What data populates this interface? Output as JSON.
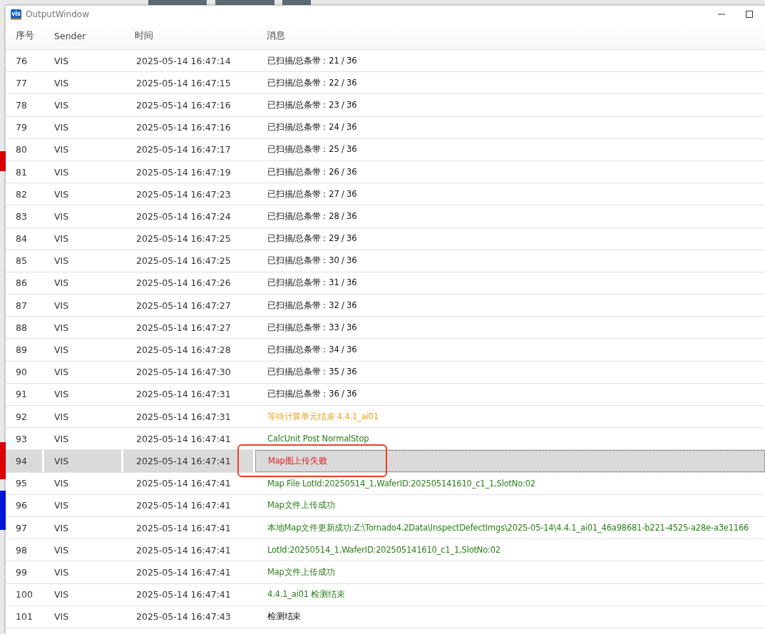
{
  "window": {
    "icon_text": "vis",
    "title": "OutputWindow"
  },
  "table": {
    "columns": [
      "序号",
      "Sender",
      "时间",
      "消息"
    ],
    "rows": [
      {
        "no": "76",
        "sender": "VIS",
        "time": "2025-05-14 16:47:14",
        "message": "已扫描/总条带：21 / 36",
        "kind": "info",
        "selected": false
      },
      {
        "no": "77",
        "sender": "VIS",
        "time": "2025-05-14 16:47:15",
        "message": "已扫描/总条带：22 / 36",
        "kind": "info",
        "selected": false
      },
      {
        "no": "78",
        "sender": "VIS",
        "time": "2025-05-14 16:47:16",
        "message": "已扫描/总条带：23 / 36",
        "kind": "info",
        "selected": false
      },
      {
        "no": "79",
        "sender": "VIS",
        "time": "2025-05-14 16:47:16",
        "message": "已扫描/总条带：24 / 36",
        "kind": "info",
        "selected": false
      },
      {
        "no": "80",
        "sender": "VIS",
        "time": "2025-05-14 16:47:17",
        "message": "已扫描/总条带：25 / 36",
        "kind": "info",
        "selected": false
      },
      {
        "no": "81",
        "sender": "VIS",
        "time": "2025-05-14 16:47:19",
        "message": "已扫描/总条带：26 / 36",
        "kind": "info",
        "selected": false
      },
      {
        "no": "82",
        "sender": "VIS",
        "time": "2025-05-14 16:47:23",
        "message": "已扫描/总条带：27 / 36",
        "kind": "info",
        "selected": false
      },
      {
        "no": "83",
        "sender": "VIS",
        "time": "2025-05-14 16:47:24",
        "message": "已扫描/总条带：28 / 36",
        "kind": "info",
        "selected": false
      },
      {
        "no": "84",
        "sender": "VIS",
        "time": "2025-05-14 16:47:25",
        "message": "已扫描/总条带：29 / 36",
        "kind": "info",
        "selected": false
      },
      {
        "no": "85",
        "sender": "VIS",
        "time": "2025-05-14 16:47:25",
        "message": "已扫描/总条带：30 / 36",
        "kind": "info",
        "selected": false
      },
      {
        "no": "86",
        "sender": "VIS",
        "time": "2025-05-14 16:47:26",
        "message": "已扫描/总条带：31 / 36",
        "kind": "info",
        "selected": false
      },
      {
        "no": "87",
        "sender": "VIS",
        "time": "2025-05-14 16:47:27",
        "message": "已扫描/总条带：32 / 36",
        "kind": "info",
        "selected": false
      },
      {
        "no": "88",
        "sender": "VIS",
        "time": "2025-05-14 16:47:27",
        "message": "已扫描/总条带：33 / 36",
        "kind": "info",
        "selected": false
      },
      {
        "no": "89",
        "sender": "VIS",
        "time": "2025-05-14 16:47:28",
        "message": "已扫描/总条带：34 / 36",
        "kind": "info",
        "selected": false
      },
      {
        "no": "90",
        "sender": "VIS",
        "time": "2025-05-14 16:47:30",
        "message": "已扫描/总条带：35 / 36",
        "kind": "info",
        "selected": false
      },
      {
        "no": "91",
        "sender": "VIS",
        "time": "2025-05-14 16:47:31",
        "message": "已扫描/总条带：36 / 36",
        "kind": "info",
        "selected": false
      },
      {
        "no": "92",
        "sender": "VIS",
        "time": "2025-05-14 16:47:31",
        "message": "等待计算单元结束 4.4.1_ai01",
        "kind": "warning",
        "selected": false
      },
      {
        "no": "93",
        "sender": "VIS",
        "time": "2025-05-14 16:47:41",
        "message": "CalcUnit Post NormalStop",
        "kind": "success",
        "selected": false
      },
      {
        "no": "94",
        "sender": "VIS",
        "time": "2025-05-14 16:47:41",
        "message": "Map图上传失败",
        "kind": "error",
        "selected": true
      },
      {
        "no": "95",
        "sender": "VIS",
        "time": "2025-05-14 16:47:41",
        "message": "Map File LotId:20250514_1,WaferID:202505141610_c1_1,SlotNo:02",
        "kind": "success",
        "selected": false
      },
      {
        "no": "96",
        "sender": "VIS",
        "time": "2025-05-14 16:47:41",
        "message": "Map文件上传成功",
        "kind": "success",
        "selected": false
      },
      {
        "no": "97",
        "sender": "VIS",
        "time": "2025-05-14 16:47:41",
        "message": "本地Map文件更新成功:Z:\\Tornado4.2Data\\InspectDefectImgs\\2025-05-14\\4.4.1_ai01_46a98681-b221-4525-a28e-a3e1166",
        "kind": "success",
        "selected": false
      },
      {
        "no": "98",
        "sender": "VIS",
        "time": "2025-05-14 16:47:41",
        "message": "LotId:20250514_1,WaferID:202505141610_c1_1,SlotNo:02",
        "kind": "success",
        "selected": false
      },
      {
        "no": "99",
        "sender": "VIS",
        "time": "2025-05-14 16:47:41",
        "message": "Map文件上传成功",
        "kind": "success",
        "selected": false
      },
      {
        "no": "100",
        "sender": "VIS",
        "time": "2025-05-14 16:47:41",
        "message": "4.4.1_ai01 检测结束",
        "kind": "success",
        "selected": false
      },
      {
        "no": "101",
        "sender": "VIS",
        "time": "2025-05-14 16:47:43",
        "message": "检测结束",
        "kind": "info",
        "selected": false
      }
    ]
  }
}
